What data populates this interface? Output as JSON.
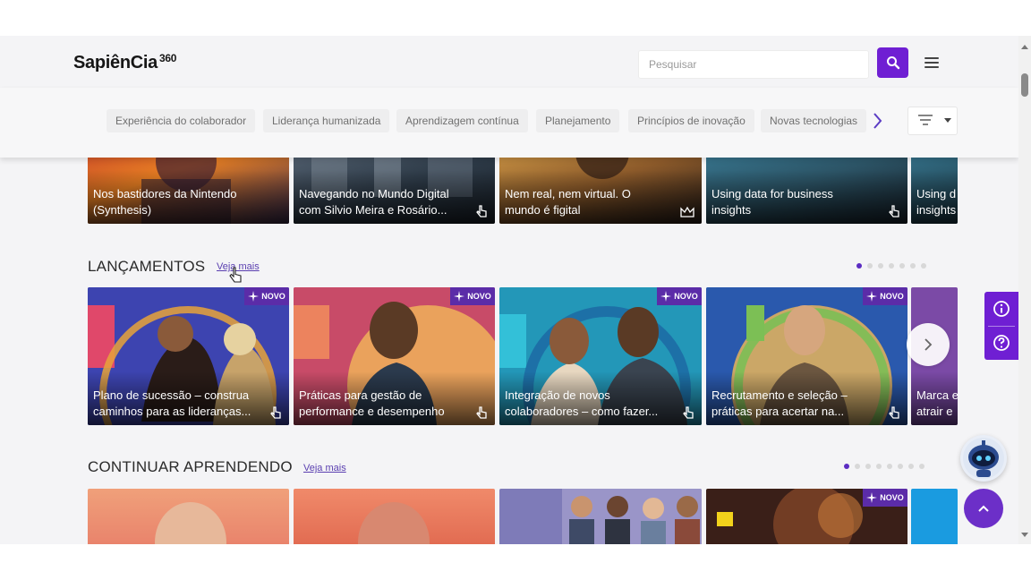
{
  "header": {
    "logo_text": "SapiênCia",
    "logo_suffix": "360",
    "search_placeholder": "Pesquisar"
  },
  "categories": [
    "Experiência do colaborador",
    "Liderança humanizada",
    "Aprendizagem contínua",
    "Planejamento",
    "Princípios de inovação",
    "Novas tecnologias"
  ],
  "top_row": {
    "cards": [
      {
        "line1": "Nos bastidores da Nintendo",
        "line2": "(Synthesis)"
      },
      {
        "line1": "Navegando no Mundo Digital",
        "line2": "com Silvio Meira e Rosário..."
      },
      {
        "line1": "Nem real, nem virtual. O",
        "line2": "mundo é figital"
      },
      {
        "line1": "Using data for business",
        "line2": "insights"
      },
      {
        "line1": "Using d",
        "line2": "insights"
      }
    ]
  },
  "lancamentos": {
    "title": "LANÇAMENTOS",
    "see_more": "Veja mais",
    "badge_label": "NOVO",
    "cards": [
      {
        "line1": "Plano de sucessão – construa",
        "line2": "caminhos para as lideranças..."
      },
      {
        "line1": "Práticas para gestão de",
        "line2": "performance e desempenho"
      },
      {
        "line1": "Integração de novos",
        "line2": "colaboradores – como fazer..."
      },
      {
        "line1": "Recrutamento e seleção –",
        "line2": "práticas para acertar na..."
      },
      {
        "line1": "Marca e",
        "line2": "atrair e"
      }
    ]
  },
  "continuar": {
    "title": "CONTINUAR APRENDENDO",
    "see_more": "Veja mais",
    "badge_label": "NOVO"
  },
  "colors": {
    "accent": "#6f1fd3",
    "badge": "#5b2ca8",
    "link": "#5a3fb0"
  },
  "icons": [
    "search-icon",
    "menu-icon",
    "chevron-right-icon",
    "filter-icon",
    "info-icon",
    "help-icon",
    "robot-icon",
    "arrow-up-icon",
    "touch-icon",
    "crown-icon",
    "sparkle-icon"
  ]
}
